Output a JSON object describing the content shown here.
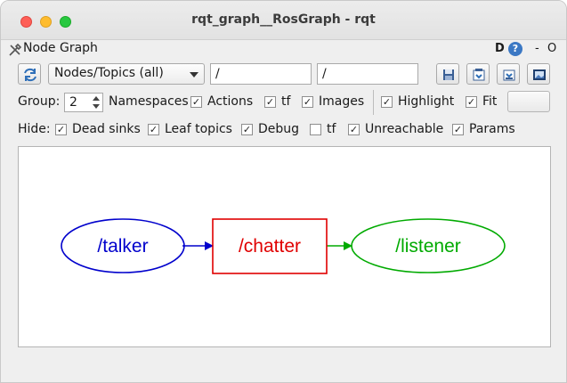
{
  "window": {
    "title": "rqt_graph__RosGraph - rqt"
  },
  "plugin": {
    "title": "Node Graph",
    "d_label": "D",
    "help_label": "?",
    "close_label": "-",
    "float_label": "O"
  },
  "toolbar": {
    "filter_mode": "Nodes/Topics (all)",
    "ns_filter": "/",
    "topic_filter": "/"
  },
  "options": {
    "group_label": "Group:",
    "group_value": "2",
    "namespaces_label": "Namespaces",
    "actions": {
      "label": "Actions",
      "checked": true
    },
    "tf": {
      "label": "tf",
      "checked": true
    },
    "images": {
      "label": "Images",
      "checked": true
    },
    "highlight": {
      "label": "Highlight",
      "checked": true
    },
    "fit": {
      "label": "Fit",
      "checked": true
    }
  },
  "hide": {
    "label": "Hide:",
    "dead_sinks": {
      "label": "Dead sinks",
      "checked": true
    },
    "leaf_topics": {
      "label": "Leaf topics",
      "checked": true
    },
    "debug": {
      "label": "Debug",
      "checked": true
    },
    "tf": {
      "label": "tf",
      "checked": false
    },
    "unreachable": {
      "label": "Unreachable",
      "checked": true
    },
    "params": {
      "label": "Params",
      "checked": true
    }
  },
  "graph": {
    "nodes": [
      {
        "id": "talker",
        "label": "/talker",
        "kind": "node",
        "color": "#0000cc"
      },
      {
        "id": "chatter",
        "label": "/chatter",
        "kind": "topic",
        "color": "#e00000"
      },
      {
        "id": "listener",
        "label": "/listener",
        "kind": "node",
        "color": "#00aa00"
      }
    ],
    "edges": [
      {
        "from": "talker",
        "to": "chatter",
        "color": "#0000cc"
      },
      {
        "from": "chatter",
        "to": "listener",
        "color": "#00aa00"
      }
    ]
  }
}
